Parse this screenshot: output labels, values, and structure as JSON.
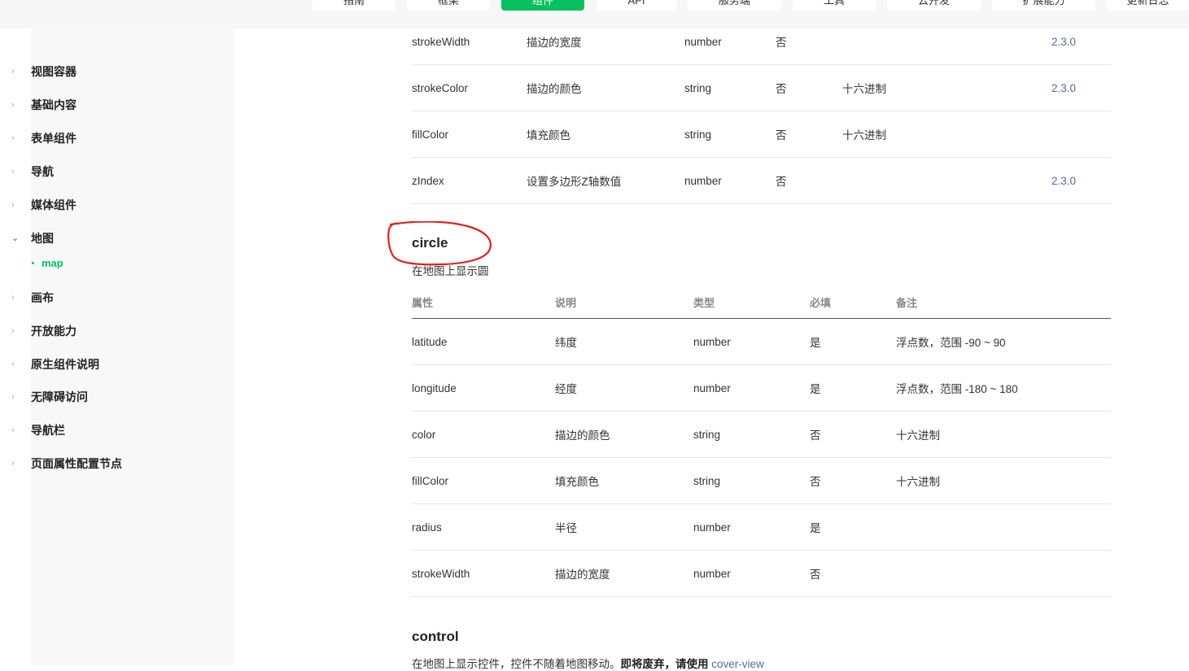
{
  "topnav": {
    "tabs": [
      "指南",
      "框架",
      "组件",
      "API",
      "服务端",
      "工具",
      "云开发",
      "扩展能力",
      "更新日志"
    ],
    "active_index": 2,
    "accent": "#07c160"
  },
  "sidebar": {
    "items": [
      {
        "label": "视图容器",
        "chevron": "chevron-right-icon"
      },
      {
        "label": "基础内容",
        "chevron": "chevron-right-icon"
      },
      {
        "label": "表单组件",
        "chevron": "chevron-right-icon"
      },
      {
        "label": "导航",
        "chevron": "chevron-right-icon"
      },
      {
        "label": "媒体组件",
        "chevron": "chevron-right-icon"
      },
      {
        "label": "地图",
        "chevron": "chevron-down-icon"
      },
      {
        "label": "画布",
        "chevron": "chevron-right-icon"
      },
      {
        "label": "开放能力",
        "chevron": "chevron-right-icon"
      },
      {
        "label": "原生组件说明",
        "chevron": "chevron-right-icon"
      },
      {
        "label": "无障碍访问",
        "chevron": "chevron-right-icon"
      },
      {
        "label": "导航栏",
        "chevron": "chevron-right-icon"
      },
      {
        "label": "页面属性配置节点",
        "chevron": "chevron-right-icon"
      }
    ],
    "sub_item": {
      "label": "map",
      "color": "#07c160"
    }
  },
  "polygon_table": {
    "rows": [
      {
        "attr": "strokeWidth",
        "desc": "描边的宽度",
        "type": "number",
        "required": "否",
        "note": "",
        "version": "2.3.0"
      },
      {
        "attr": "strokeColor",
        "desc": "描边的颜色",
        "type": "string",
        "required": "否",
        "note": "十六进制",
        "version": "2.3.0"
      },
      {
        "attr": "fillColor",
        "desc": "填充颜色",
        "type": "string",
        "required": "否",
        "note": "十六进制",
        "version": ""
      },
      {
        "attr": "zIndex",
        "desc": "设置多边形Z轴数值",
        "type": "number",
        "required": "否",
        "note": "",
        "version": "2.3.0"
      }
    ]
  },
  "circle": {
    "title": "circle",
    "desc": "在地图上显示圆",
    "headers": {
      "attr": "属性",
      "desc": "说明",
      "type": "类型",
      "required": "必填",
      "note": "备注"
    },
    "rows": [
      {
        "attr": "latitude",
        "desc": "纬度",
        "type": "number",
        "required": "是",
        "note": "浮点数，范围 -90 ~ 90"
      },
      {
        "attr": "longitude",
        "desc": "经度",
        "type": "number",
        "required": "是",
        "note": "浮点数，范围 -180 ~ 180"
      },
      {
        "attr": "color",
        "desc": "描边的颜色",
        "type": "string",
        "required": "否",
        "note": "十六进制"
      },
      {
        "attr": "fillColor",
        "desc": "填充颜色",
        "type": "string",
        "required": "否",
        "note": "十六进制"
      },
      {
        "attr": "radius",
        "desc": "半径",
        "type": "number",
        "required": "是",
        "note": ""
      },
      {
        "attr": "strokeWidth",
        "desc": "描边的宽度",
        "type": "number",
        "required": "否",
        "note": ""
      }
    ],
    "highlight_color": "#e02020"
  },
  "control": {
    "title": "control",
    "desc_prefix": "在地图上显示控件，控件不随着地图移动。",
    "desc_strong": "即将废弃，请使用",
    "desc_link": "cover-view"
  },
  "colors": {
    "version_link": "#576b95"
  }
}
